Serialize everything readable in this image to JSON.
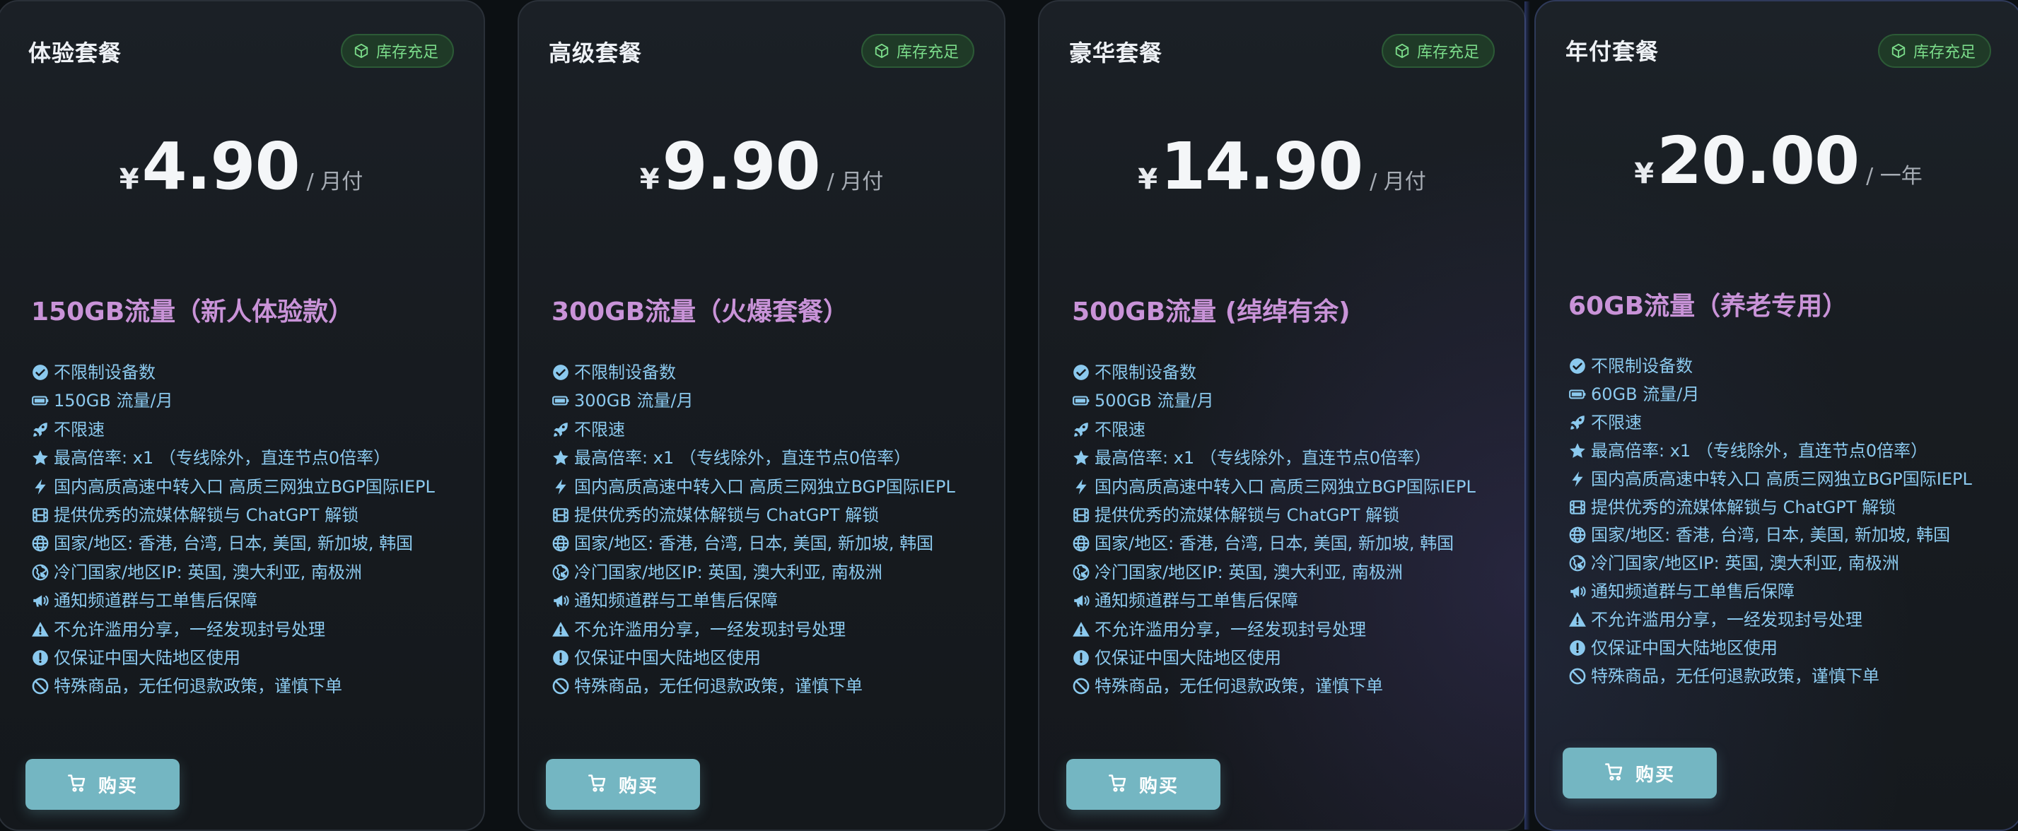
{
  "colors": {
    "background": "#0c1013",
    "accent": "#74b6c2",
    "traffic_title": "#c993d8",
    "feature_text": "#8bc9ee",
    "badge_text": "#7bdc8a"
  },
  "plans": [
    {
      "name": "体验套餐",
      "badge": "库存充足",
      "currency": "¥",
      "price": "4.90",
      "period": "/ 月付",
      "traffic": "150GB流量（新人体验款）",
      "features": [
        {
          "icon": "check-circle-icon",
          "text": "不限制设备数"
        },
        {
          "icon": "battery-icon",
          "text": "150GB 流量/月"
        },
        {
          "icon": "rocket-icon",
          "text": "不限速"
        },
        {
          "icon": "star-icon",
          "text": "最高倍率: x1 （专线除外，直连节点0倍率）"
        },
        {
          "icon": "bolt-icon",
          "text": "国内高质高速中转入口 高质三网独立BGP国际IEPL"
        },
        {
          "icon": "film-icon",
          "text": "提供优秀的流媒体解锁与 ChatGPT 解锁"
        },
        {
          "icon": "globe-icon",
          "text": "国家/地区: 香港, 台湾, 日本, 美国, 新加坡, 韩国"
        },
        {
          "icon": "earth-icon",
          "text": "冷门国家/地区IP: 英国, 澳大利亚, 南极洲"
        },
        {
          "icon": "megaphone-icon",
          "text": "通知频道群与工单售后保障"
        },
        {
          "icon": "warning-icon",
          "text": "不允许滥用分享，一经发现封号处理"
        },
        {
          "icon": "exclamation-circle-icon",
          "text": "仅保证中国大陆地区使用"
        },
        {
          "icon": "ban-icon",
          "text": "特殊商品，无任何退款政策，谨慎下单"
        }
      ],
      "buy_label": "购买"
    },
    {
      "name": "高级套餐",
      "badge": "库存充足",
      "currency": "¥",
      "price": "9.90",
      "period": "/ 月付",
      "traffic": "300GB流量（火爆套餐）",
      "features": [
        {
          "icon": "check-circle-icon",
          "text": "不限制设备数"
        },
        {
          "icon": "battery-icon",
          "text": "300GB 流量/月"
        },
        {
          "icon": "rocket-icon",
          "text": "不限速"
        },
        {
          "icon": "star-icon",
          "text": "最高倍率: x1 （专线除外，直连节点0倍率）"
        },
        {
          "icon": "bolt-icon",
          "text": "国内高质高速中转入口 高质三网独立BGP国际IEPL"
        },
        {
          "icon": "film-icon",
          "text": "提供优秀的流媒体解锁与 ChatGPT 解锁"
        },
        {
          "icon": "globe-icon",
          "text": "国家/地区: 香港, 台湾, 日本, 美国, 新加坡, 韩国"
        },
        {
          "icon": "earth-icon",
          "text": "冷门国家/地区IP: 英国, 澳大利亚, 南极洲"
        },
        {
          "icon": "megaphone-icon",
          "text": "通知频道群与工单售后保障"
        },
        {
          "icon": "warning-icon",
          "text": "不允许滥用分享，一经发现封号处理"
        },
        {
          "icon": "exclamation-circle-icon",
          "text": "仅保证中国大陆地区使用"
        },
        {
          "icon": "ban-icon",
          "text": "特殊商品，无任何退款政策，谨慎下单"
        }
      ],
      "buy_label": "购买"
    },
    {
      "name": "豪华套餐",
      "badge": "库存充足",
      "currency": "¥",
      "price": "14.90",
      "period": "/ 月付",
      "traffic": "500GB流量 (绰绰有余)",
      "features": [
        {
          "icon": "check-circle-icon",
          "text": "不限制设备数"
        },
        {
          "icon": "battery-icon",
          "text": "500GB 流量/月"
        },
        {
          "icon": "rocket-icon",
          "text": "不限速"
        },
        {
          "icon": "star-icon",
          "text": "最高倍率: x1 （专线除外，直连节点0倍率）"
        },
        {
          "icon": "bolt-icon",
          "text": "国内高质高速中转入口 高质三网独立BGP国际IEPL"
        },
        {
          "icon": "film-icon",
          "text": "提供优秀的流媒体解锁与 ChatGPT 解锁"
        },
        {
          "icon": "globe-icon",
          "text": "国家/地区: 香港, 台湾, 日本, 美国, 新加坡, 韩国"
        },
        {
          "icon": "earth-icon",
          "text": "冷门国家/地区IP: 英国, 澳大利亚, 南极洲"
        },
        {
          "icon": "megaphone-icon",
          "text": "通知频道群与工单售后保障"
        },
        {
          "icon": "warning-icon",
          "text": "不允许滥用分享，一经发现封号处理"
        },
        {
          "icon": "exclamation-circle-icon",
          "text": "仅保证中国大陆地区使用"
        },
        {
          "icon": "ban-icon",
          "text": "特殊商品，无任何退款政策，谨慎下单"
        }
      ],
      "buy_label": "购买"
    },
    {
      "name": "年付套餐",
      "badge": "库存充足",
      "currency": "¥",
      "price": "20.00",
      "period": "/ 一年",
      "traffic": "60GB流量（养老专用）",
      "features": [
        {
          "icon": "check-circle-icon",
          "text": "不限制设备数"
        },
        {
          "icon": "battery-icon",
          "text": "60GB 流量/月"
        },
        {
          "icon": "rocket-icon",
          "text": "不限速"
        },
        {
          "icon": "star-icon",
          "text": "最高倍率: x1 （专线除外，直连节点0倍率）"
        },
        {
          "icon": "bolt-icon",
          "text": "国内高质高速中转入口 高质三网独立BGP国际IEPL"
        },
        {
          "icon": "film-icon",
          "text": "提供优秀的流媒体解锁与 ChatGPT 解锁"
        },
        {
          "icon": "globe-icon",
          "text": "国家/地区: 香港, 台湾, 日本, 美国, 新加坡, 韩国"
        },
        {
          "icon": "earth-icon",
          "text": "冷门国家/地区IP: 英国, 澳大利亚, 南极洲"
        },
        {
          "icon": "megaphone-icon",
          "text": "通知频道群与工单售后保障"
        },
        {
          "icon": "warning-icon",
          "text": "不允许滥用分享，一经发现封号处理"
        },
        {
          "icon": "exclamation-circle-icon",
          "text": "仅保证中国大陆地区使用"
        },
        {
          "icon": "ban-icon",
          "text": "特殊商品，无任何退款政策，谨慎下单"
        }
      ],
      "buy_label": "购买"
    }
  ]
}
